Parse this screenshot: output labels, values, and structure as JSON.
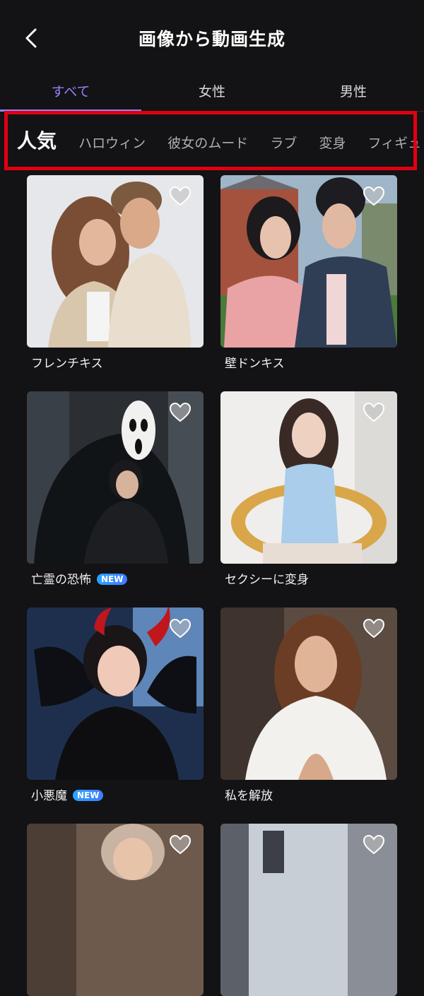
{
  "header": {
    "title": "画像から動画生成",
    "back_icon": "chevron-left-icon"
  },
  "tabs": [
    {
      "label": "すべて",
      "active": true
    },
    {
      "label": "女性",
      "active": false
    },
    {
      "label": "男性",
      "active": false
    }
  ],
  "subcategories": [
    {
      "label": "人気",
      "active": true
    },
    {
      "label": "ハロウィン"
    },
    {
      "label": "彼女のムード"
    },
    {
      "label": "ラブ"
    },
    {
      "label": "変身"
    },
    {
      "label": "フィギュ"
    }
  ],
  "colors": {
    "accent": "#8e84ff",
    "highlight": "#e00012",
    "background": "#131214",
    "badge": "#2aa6ff"
  },
  "cards": [
    {
      "label": "フレンチキス",
      "badge": null,
      "icon": "heart-outline-icon"
    },
    {
      "label": "壁ドンキス",
      "badge": null,
      "icon": "heart-outline-icon"
    },
    {
      "label": "亡霊の恐怖",
      "badge": "NEW",
      "icon": "heart-outline-icon"
    },
    {
      "label": "セクシーに変身",
      "badge": null,
      "icon": "heart-outline-icon"
    },
    {
      "label": "小悪魔",
      "badge": "NEW",
      "icon": "heart-outline-icon"
    },
    {
      "label": "私を解放",
      "badge": null,
      "icon": "heart-outline-icon"
    },
    {
      "label": "",
      "badge": null,
      "icon": "heart-outline-icon"
    },
    {
      "label": "",
      "badge": null,
      "icon": "heart-outline-icon"
    }
  ]
}
